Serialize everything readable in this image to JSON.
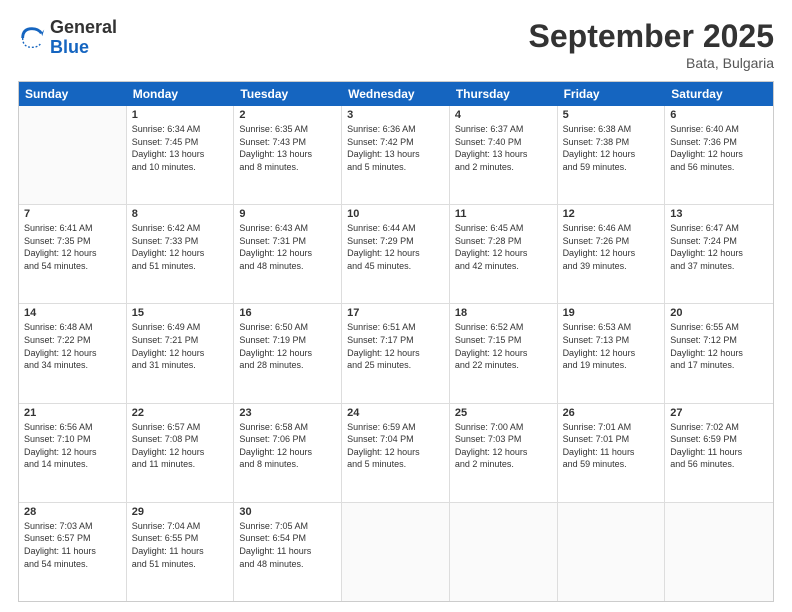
{
  "header": {
    "logo_general": "General",
    "logo_blue": "Blue",
    "month_title": "September 2025",
    "location": "Bata, Bulgaria"
  },
  "weekdays": [
    "Sunday",
    "Monday",
    "Tuesday",
    "Wednesday",
    "Thursday",
    "Friday",
    "Saturday"
  ],
  "rows": [
    [
      {
        "day": "",
        "info": ""
      },
      {
        "day": "1",
        "info": "Sunrise: 6:34 AM\nSunset: 7:45 PM\nDaylight: 13 hours\nand 10 minutes."
      },
      {
        "day": "2",
        "info": "Sunrise: 6:35 AM\nSunset: 7:43 PM\nDaylight: 13 hours\nand 8 minutes."
      },
      {
        "day": "3",
        "info": "Sunrise: 6:36 AM\nSunset: 7:42 PM\nDaylight: 13 hours\nand 5 minutes."
      },
      {
        "day": "4",
        "info": "Sunrise: 6:37 AM\nSunset: 7:40 PM\nDaylight: 13 hours\nand 2 minutes."
      },
      {
        "day": "5",
        "info": "Sunrise: 6:38 AM\nSunset: 7:38 PM\nDaylight: 12 hours\nand 59 minutes."
      },
      {
        "day": "6",
        "info": "Sunrise: 6:40 AM\nSunset: 7:36 PM\nDaylight: 12 hours\nand 56 minutes."
      }
    ],
    [
      {
        "day": "7",
        "info": "Sunrise: 6:41 AM\nSunset: 7:35 PM\nDaylight: 12 hours\nand 54 minutes."
      },
      {
        "day": "8",
        "info": "Sunrise: 6:42 AM\nSunset: 7:33 PM\nDaylight: 12 hours\nand 51 minutes."
      },
      {
        "day": "9",
        "info": "Sunrise: 6:43 AM\nSunset: 7:31 PM\nDaylight: 12 hours\nand 48 minutes."
      },
      {
        "day": "10",
        "info": "Sunrise: 6:44 AM\nSunset: 7:29 PM\nDaylight: 12 hours\nand 45 minutes."
      },
      {
        "day": "11",
        "info": "Sunrise: 6:45 AM\nSunset: 7:28 PM\nDaylight: 12 hours\nand 42 minutes."
      },
      {
        "day": "12",
        "info": "Sunrise: 6:46 AM\nSunset: 7:26 PM\nDaylight: 12 hours\nand 39 minutes."
      },
      {
        "day": "13",
        "info": "Sunrise: 6:47 AM\nSunset: 7:24 PM\nDaylight: 12 hours\nand 37 minutes."
      }
    ],
    [
      {
        "day": "14",
        "info": "Sunrise: 6:48 AM\nSunset: 7:22 PM\nDaylight: 12 hours\nand 34 minutes."
      },
      {
        "day": "15",
        "info": "Sunrise: 6:49 AM\nSunset: 7:21 PM\nDaylight: 12 hours\nand 31 minutes."
      },
      {
        "day": "16",
        "info": "Sunrise: 6:50 AM\nSunset: 7:19 PM\nDaylight: 12 hours\nand 28 minutes."
      },
      {
        "day": "17",
        "info": "Sunrise: 6:51 AM\nSunset: 7:17 PM\nDaylight: 12 hours\nand 25 minutes."
      },
      {
        "day": "18",
        "info": "Sunrise: 6:52 AM\nSunset: 7:15 PM\nDaylight: 12 hours\nand 22 minutes."
      },
      {
        "day": "19",
        "info": "Sunrise: 6:53 AM\nSunset: 7:13 PM\nDaylight: 12 hours\nand 19 minutes."
      },
      {
        "day": "20",
        "info": "Sunrise: 6:55 AM\nSunset: 7:12 PM\nDaylight: 12 hours\nand 17 minutes."
      }
    ],
    [
      {
        "day": "21",
        "info": "Sunrise: 6:56 AM\nSunset: 7:10 PM\nDaylight: 12 hours\nand 14 minutes."
      },
      {
        "day": "22",
        "info": "Sunrise: 6:57 AM\nSunset: 7:08 PM\nDaylight: 12 hours\nand 11 minutes."
      },
      {
        "day": "23",
        "info": "Sunrise: 6:58 AM\nSunset: 7:06 PM\nDaylight: 12 hours\nand 8 minutes."
      },
      {
        "day": "24",
        "info": "Sunrise: 6:59 AM\nSunset: 7:04 PM\nDaylight: 12 hours\nand 5 minutes."
      },
      {
        "day": "25",
        "info": "Sunrise: 7:00 AM\nSunset: 7:03 PM\nDaylight: 12 hours\nand 2 minutes."
      },
      {
        "day": "26",
        "info": "Sunrise: 7:01 AM\nSunset: 7:01 PM\nDaylight: 11 hours\nand 59 minutes."
      },
      {
        "day": "27",
        "info": "Sunrise: 7:02 AM\nSunset: 6:59 PM\nDaylight: 11 hours\nand 56 minutes."
      }
    ],
    [
      {
        "day": "28",
        "info": "Sunrise: 7:03 AM\nSunset: 6:57 PM\nDaylight: 11 hours\nand 54 minutes."
      },
      {
        "day": "29",
        "info": "Sunrise: 7:04 AM\nSunset: 6:55 PM\nDaylight: 11 hours\nand 51 minutes."
      },
      {
        "day": "30",
        "info": "Sunrise: 7:05 AM\nSunset: 6:54 PM\nDaylight: 11 hours\nand 48 minutes."
      },
      {
        "day": "",
        "info": ""
      },
      {
        "day": "",
        "info": ""
      },
      {
        "day": "",
        "info": ""
      },
      {
        "day": "",
        "info": ""
      }
    ]
  ]
}
